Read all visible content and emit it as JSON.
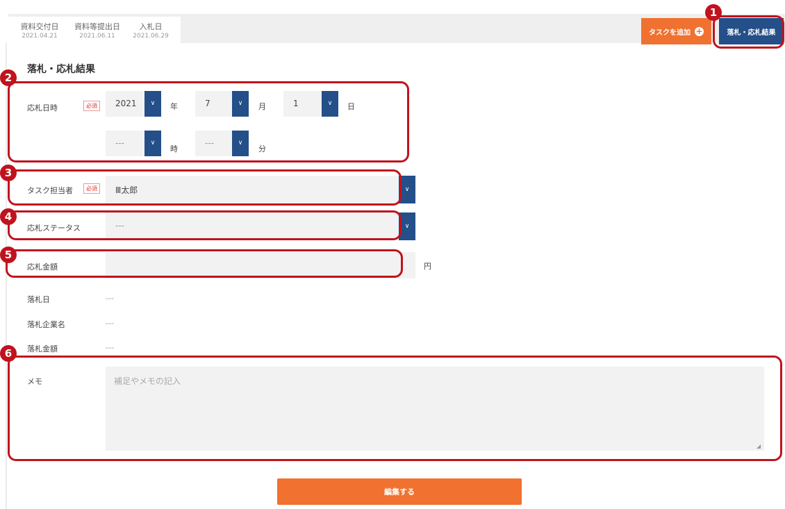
{
  "header": {
    "date_tabs": [
      {
        "label": "資料交付日",
        "date": "2021.04.21"
      },
      {
        "label": "資料等提出日",
        "date": "2021.06.11"
      },
      {
        "label": "入札日",
        "date": "2021.06.29"
      }
    ],
    "add_task_label": "タスクを追加",
    "add_icon": "plus-circle-icon",
    "result_label": "落札・応札結果"
  },
  "form": {
    "title": "落札・応札結果",
    "required_badge": "必須",
    "bid_datetime": {
      "label": "応札日時",
      "year": "2021",
      "year_unit": "年",
      "month": "7",
      "month_unit": "月",
      "day": "1",
      "day_unit": "日",
      "hour": "---",
      "hour_unit": "時",
      "minute": "---",
      "minute_unit": "分"
    },
    "assignee": {
      "label": "タスク担当者",
      "value": "Ⅲ太郎"
    },
    "bid_status": {
      "label": "応札ステータス",
      "value": "---"
    },
    "bid_amount": {
      "label": "応札金額",
      "value": "",
      "unit": "円"
    },
    "award_date": {
      "label": "落札日",
      "value": "---"
    },
    "award_company": {
      "label": "落札企業名",
      "value": "---"
    },
    "award_amount": {
      "label": "落札金額",
      "value": "---"
    },
    "memo": {
      "label": "メモ",
      "placeholder": "補足やメモの記入"
    },
    "edit_button": "編集する"
  },
  "annotations": [
    "1",
    "2",
    "3",
    "4",
    "5",
    "6"
  ],
  "colors": {
    "accent_orange": "#f07130",
    "navy": "#244f88",
    "callout_red": "#c0131d"
  }
}
